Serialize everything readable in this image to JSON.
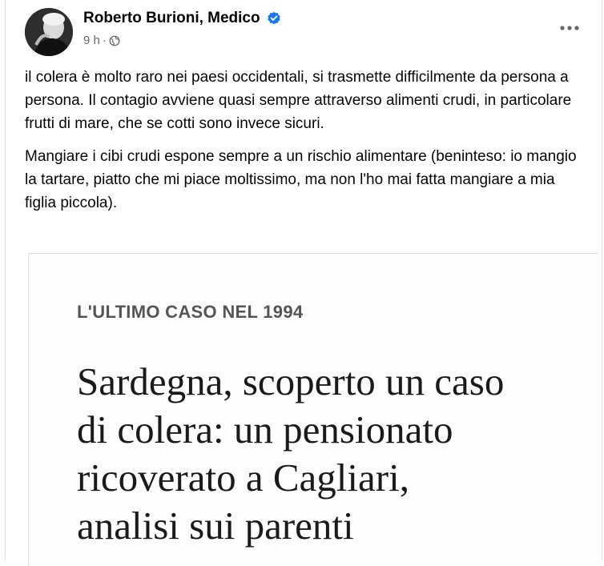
{
  "post": {
    "author": "Roberto Burioni, Medico",
    "verified_icon": "verified-badge-icon",
    "time": "9 h",
    "separator": "·",
    "audience_icon": "globe-icon",
    "more_icon": "more-options-icon",
    "paragraphs": [
      "il colera è molto raro nei paesi occidentali, si trasmette difficilmente da persona a persona. Il contagio avviene quasi sempre attraverso alimenti crudi, in particolare frutti di mare, che se cotti sono invece sicuri.",
      "Mangiare i cibi crudi espone sempre a un rischio alimentare (beninteso: io mangio la tartare, piatto che mi piace moltissimo, ma non l'ho mai fatta mangiare a mia figlia piccola)."
    ]
  },
  "article": {
    "kicker": "L'ULTIMO CASO NEL 1994",
    "headline_lines": [
      "Sardegna, scoperto un caso",
      "di colera: un pensionato",
      "ricoverato a Cagliari,",
      "analisi sui parenti"
    ]
  },
  "colors": {
    "verified_blue": "#1877f2",
    "secondary_text": "#65676b"
  }
}
